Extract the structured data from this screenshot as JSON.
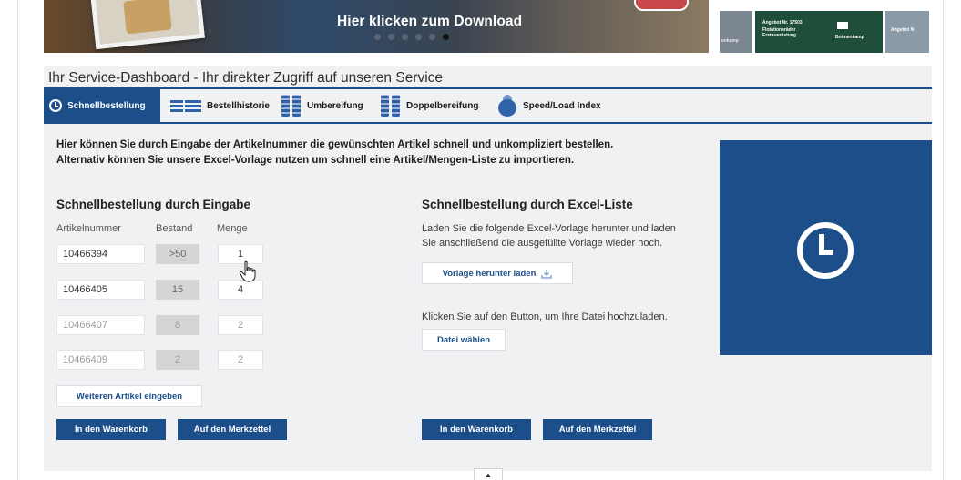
{
  "banner": {
    "title": "Hier klicken zum Download",
    "slides": 6,
    "active_slide": 6,
    "thumb_1": "enkamp",
    "thumb_2_title": "Angebot Nr. 17503",
    "thumb_2_line1": "Flotationsräder",
    "thumb_2_line2": "Erstausrüstung",
    "thumb_2_brand": "Bohnenkamp",
    "thumb_3": "Angebot N"
  },
  "dashboard": {
    "title": "Ihr Service-Dashboard - Ihr direkter Zugriff auf unseren Service",
    "tabs": [
      {
        "label": "Schnellbestellung",
        "icon": "clock-icon",
        "active": true
      },
      {
        "label": "Bestellhistorie",
        "icon": "list-icon",
        "active": false
      },
      {
        "label": "Umbereifung",
        "icon": "tire-swap-icon",
        "active": false
      },
      {
        "label": "Doppelbereifung",
        "icon": "double-tire-icon",
        "active": false
      },
      {
        "label": "Speed/Load Index",
        "icon": "speedometer-icon",
        "active": false
      }
    ],
    "intro_line1": "Hier können Sie durch Eingabe der Artikelnummer die gewünschten Artikel schnell und unkompliziert bestellen.",
    "intro_line2": "Alternativ können Sie unsere Excel-Vorlage nutzen um schnell eine Artikel/Mengen-Liste zu importieren."
  },
  "quick_order": {
    "heading": "Schnellbestellung durch Eingabe",
    "columns": [
      "Artikelnummer",
      "Bestand",
      "Menge"
    ],
    "rows": [
      {
        "article": "10466394",
        "stock": ">50",
        "qty": "1"
      },
      {
        "article": "10466405",
        "stock": "15",
        "qty": "4"
      },
      {
        "article": "10466407",
        "stock": "8",
        "qty": "2"
      },
      {
        "article": "10466409",
        "stock": "2",
        "qty": "2"
      }
    ],
    "add_button": "Weiteren Artikel eingeben",
    "cart_button": "In den Warenkorb",
    "wishlist_button": "Auf den Merkzettel"
  },
  "excel_order": {
    "heading": "Schnellbestellung durch Excel-Liste",
    "text1_line1": "Laden Sie die folgende Excel-Vorlage herunter und laden",
    "text1_line2": "Sie anschließend die ausgefüllte Vorlage wieder hoch.",
    "download_button": "Vorlage herunter laden",
    "text2": "Klicken Sie auf den Button, um Ihre Datei hochzuladen.",
    "file_button": "Datei wählen",
    "cart_button": "In den Warenkorb",
    "wishlist_button": "Auf den Merkzettel"
  },
  "scroll_top": "▲",
  "colors": {
    "primary": "#1c4f8a",
    "panel_bg": "#f0f1f3",
    "stock_bg": "#d4d5d7"
  }
}
